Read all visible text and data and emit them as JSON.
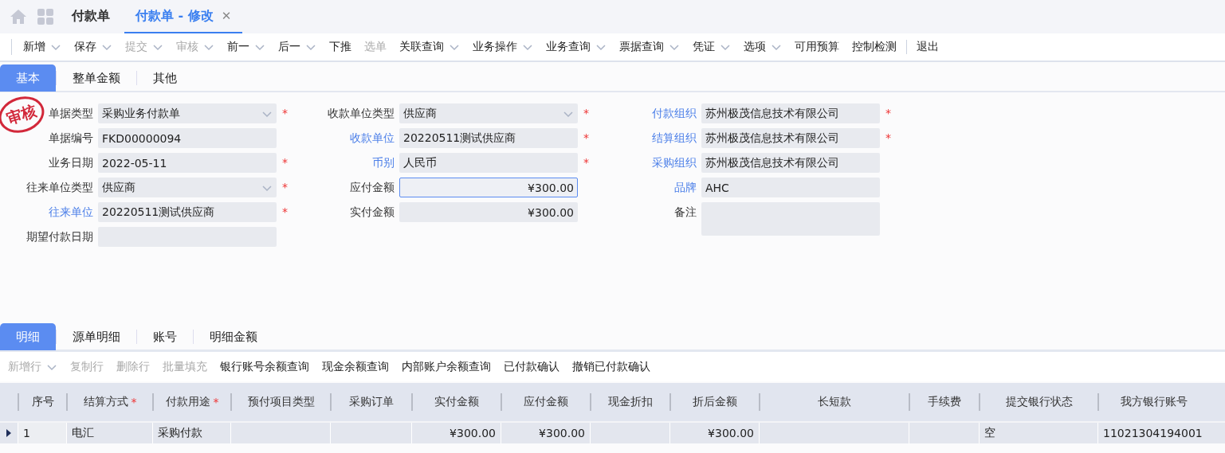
{
  "page_tabs": [
    {
      "label": "付款单",
      "selected": false,
      "closable": false
    },
    {
      "label": "付款单 - 修改",
      "selected": true,
      "closable": true
    }
  ],
  "close_glyph": "✕",
  "required_mark": "*",
  "toolbar": [
    {
      "label": "新增",
      "dropdown": true,
      "disabled": false
    },
    {
      "label": "保存",
      "dropdown": true,
      "disabled": false
    },
    {
      "label": "提交",
      "dropdown": true,
      "disabled": true
    },
    {
      "label": "审核",
      "dropdown": true,
      "disabled": true
    },
    {
      "label": "前一",
      "dropdown": true,
      "disabled": false
    },
    {
      "label": "后一",
      "dropdown": true,
      "disabled": false
    },
    {
      "label": "下推",
      "dropdown": false,
      "disabled": false
    },
    {
      "label": "选单",
      "dropdown": false,
      "disabled": true
    },
    {
      "label": "关联查询",
      "dropdown": true,
      "disabled": false
    },
    {
      "label": "业务操作",
      "dropdown": true,
      "disabled": false
    },
    {
      "label": "业务查询",
      "dropdown": true,
      "disabled": false
    },
    {
      "label": "票据查询",
      "dropdown": true,
      "disabled": false
    },
    {
      "label": "凭证",
      "dropdown": true,
      "disabled": false
    },
    {
      "label": "选项",
      "dropdown": true,
      "disabled": false
    },
    {
      "label": "可用预算",
      "dropdown": false,
      "disabled": false
    },
    {
      "label": "控制检测",
      "dropdown": false,
      "disabled": false
    },
    {
      "label": "退出",
      "dropdown": false,
      "disabled": false,
      "divider_before": true
    }
  ],
  "form_tabs": [
    {
      "label": "基本",
      "selected": true
    },
    {
      "label": "整单金额",
      "selected": false
    },
    {
      "label": "其他",
      "selected": false
    }
  ],
  "stamp": "审核",
  "form_columns": [
    [
      {
        "label": "单据类型",
        "value": "采购业务付款单",
        "kind": "select",
        "link": false,
        "required": true
      },
      {
        "label": "单据编号",
        "value": "FKD00000094",
        "kind": "text",
        "link": false,
        "required": false
      },
      {
        "label": "业务日期",
        "value": "2022-05-11",
        "kind": "text",
        "link": false,
        "required": true
      },
      {
        "label": "往来单位类型",
        "value": "供应商",
        "kind": "select",
        "link": false,
        "required": true
      },
      {
        "label": "往来单位",
        "value": "20220511测试供应商",
        "kind": "text",
        "link": true,
        "required": true
      },
      {
        "label": "期望付款日期",
        "kind": "text",
        "link": false,
        "required": false
      }
    ],
    [
      {
        "label": "收款单位类型",
        "value": "供应商",
        "kind": "select",
        "link": false,
        "required": true
      },
      {
        "label": "收款单位",
        "value": "20220511测试供应商",
        "kind": "text",
        "link": true,
        "required": true
      },
      {
        "label": "币别",
        "value": "人民币",
        "kind": "text",
        "link": true,
        "required": true
      },
      {
        "label": "应付金额",
        "value": "¥300.00",
        "kind": "amount",
        "link": false,
        "required": false,
        "focused": true
      },
      {
        "label": "实付金额",
        "value": "¥300.00",
        "kind": "amount",
        "link": false,
        "required": false
      }
    ],
    [
      {
        "label": "付款组织",
        "value": "苏州极茂信息技术有限公司",
        "kind": "text",
        "link": true,
        "required": true
      },
      {
        "label": "结算组织",
        "value": "苏州极茂信息技术有限公司",
        "kind": "text",
        "link": true,
        "required": true
      },
      {
        "label": "采购组织",
        "value": "苏州极茂信息技术有限公司",
        "kind": "text",
        "link": true,
        "required": false
      },
      {
        "label": "品牌",
        "value": "AHC",
        "kind": "text",
        "link": true,
        "required": false
      },
      {
        "label": "备注",
        "kind": "textarea",
        "link": false,
        "required": false
      }
    ]
  ],
  "detail_tabs": [
    {
      "label": "明细",
      "selected": true
    },
    {
      "label": "源单明细",
      "selected": false
    },
    {
      "label": "账号",
      "selected": false
    },
    {
      "label": "明细金额",
      "selected": false
    }
  ],
  "detail_toolbar": [
    {
      "label": "新增行",
      "dropdown": true,
      "disabled": true
    },
    {
      "label": "复制行",
      "dropdown": false,
      "disabled": true
    },
    {
      "label": "删除行",
      "dropdown": false,
      "disabled": true
    },
    {
      "label": "批量填充",
      "dropdown": false,
      "disabled": true
    },
    {
      "label": "银行账号余额查询",
      "dropdown": false,
      "disabled": false
    },
    {
      "label": "现金余额查询",
      "dropdown": false,
      "disabled": false
    },
    {
      "label": "内部账户余额查询",
      "dropdown": false,
      "disabled": false
    },
    {
      "label": "已付款确认",
      "dropdown": false,
      "disabled": false
    },
    {
      "label": "撤销已付款确认",
      "dropdown": false,
      "disabled": false
    }
  ],
  "table": {
    "columns": [
      {
        "label": "序号",
        "required": false
      },
      {
        "label": "结算方式",
        "required": true
      },
      {
        "label": "付款用途",
        "required": true
      },
      {
        "label": "预付项目类型",
        "required": false
      },
      {
        "label": "采购订单",
        "required": false
      },
      {
        "label": "实付金额",
        "required": false
      },
      {
        "label": "应付金额",
        "required": false
      },
      {
        "label": "现金折扣",
        "required": false
      },
      {
        "label": "折后金额",
        "required": false
      },
      {
        "label": "长短款",
        "required": false
      },
      {
        "label": "手续费",
        "required": false
      },
      {
        "label": "提交银行状态",
        "required": false
      },
      {
        "label": "我方银行账号",
        "required": false
      }
    ],
    "rows": [
      {
        "current": true,
        "cells": [
          "1",
          "电汇",
          "采购付款",
          "",
          "",
          "¥300.00",
          "¥300.00",
          "",
          "¥300.00",
          "",
          "",
          "空",
          "11021304194001"
        ]
      }
    ]
  }
}
